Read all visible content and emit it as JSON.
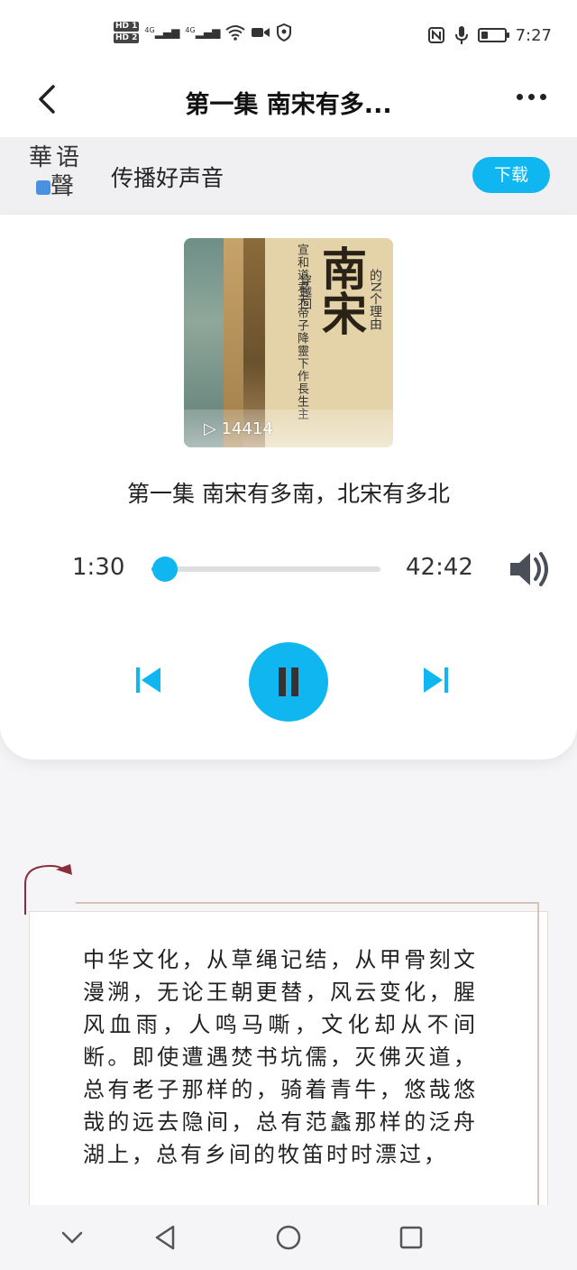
{
  "status_bar": {
    "hd1": "HD 1",
    "hd2": "HD 2",
    "sig1": "4G",
    "sig2": "4G",
    "time": "7:27",
    "battery_level": 0.3
  },
  "header": {
    "back_icon": "chevron-left-icon",
    "title": "第一集 南宋有多...",
    "more_icon": "more-horizontal-icon"
  },
  "banner": {
    "logo_chars": [
      "華",
      "语",
      "聲"
    ],
    "slogan": "传播好声音",
    "download_label": "下载"
  },
  "player": {
    "cover": {
      "calligraphy": "宣和道君天帝子降靈下作長生主",
      "calligraphy2": "風流不混世間塵清出水潼湯秋",
      "side_text": "穿越回",
      "big_title": "南宋",
      "subtitle": "的N个理由",
      "play_count": "▷ 14414"
    },
    "episode_title": "第一集 南宋有多南，北宋有多北",
    "current_time": "1:30",
    "total_time": "42:42",
    "progress": 0.035,
    "state": "playing"
  },
  "article": {
    "text": "中华文化，从草绳记结，从甲骨刻文漫溯，无论王朝更替，风云变化，腥风血雨，人鸣马嘶，文化却从不间断。即使遭遇焚书坑儒，灭佛灭道，总有老子那样的，骑着青牛，悠哉悠哉的远去隐间，总有范蠡那样的泛舟湖上，总有乡间的牧笛时时漂过，"
  },
  "colors": {
    "accent": "#10b6f0",
    "icon_dark": "#333333"
  }
}
